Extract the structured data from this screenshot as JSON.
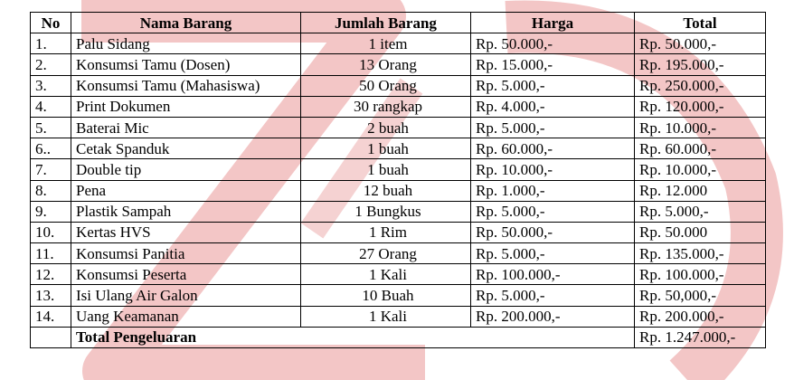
{
  "columns": {
    "no": "No",
    "item": "Nama Barang",
    "qty": "Jumlah Barang",
    "price": "Harga",
    "total": "Total"
  },
  "rows": [
    {
      "no": "1.",
      "item": "Palu Sidang",
      "qty": "1 item",
      "price": "Rp. 50.000,-",
      "total": "Rp. 50.000,-"
    },
    {
      "no": "2.",
      "item": "Konsumsi Tamu (Dosen)",
      "qty": "13 Orang",
      "price": "Rp. 15.000,-",
      "total": "Rp. 195.000,-"
    },
    {
      "no": "3.",
      "item": "Konsumsi Tamu (Mahasiswa)",
      "qty": "50 Orang",
      "price": "Rp. 5.000,-",
      "total": "Rp. 250.000,-"
    },
    {
      "no": "4.",
      "item": "Print Dokumen",
      "qty": "30 rangkap",
      "price": "Rp. 4.000,-",
      "total": "Rp. 120.000,-"
    },
    {
      "no": "5.",
      "item": "Baterai Mic",
      "qty": "2 buah",
      "price": "Rp. 5.000,-",
      "total": "Rp. 10.000,-"
    },
    {
      "no": "6..",
      "item": "Cetak Spanduk",
      "qty": "1 buah",
      "price": "Rp. 60.000,-",
      "total": "Rp. 60.000,-"
    },
    {
      "no": "7.",
      "item": "Double tip",
      "qty": "1 buah",
      "price": "Rp. 10.000,-",
      "total": "Rp. 10.000,-"
    },
    {
      "no": "8.",
      "item": "Pena",
      "qty": "12 buah",
      "price": "Rp. 1.000,-",
      "total": "Rp. 12.000"
    },
    {
      "no": "9.",
      "item": "Plastik Sampah",
      "qty": "1 Bungkus",
      "price": "Rp. 5.000,-",
      "total": "Rp. 5.000,-"
    },
    {
      "no": "10.",
      "item": "Kertas HVS",
      "qty": "1 Rim",
      "price": "Rp. 50.000,-",
      "total": "Rp. 50.000"
    },
    {
      "no": "11.",
      "item": "Konsumsi Panitia",
      "qty": "27 Orang",
      "price": "Rp. 5.000,-",
      "total": "Rp. 135.000,-"
    },
    {
      "no": "12.",
      "item": "Konsumsi Peserta",
      "qty": "1 Kali",
      "price": "Rp. 100.000,-",
      "total": "Rp. 100.000,-"
    },
    {
      "no": "13.",
      "item": "Isi Ulang Air Galon",
      "qty": "10 Buah",
      "price": "Rp. 5.000,-",
      "total": "Rp. 50,000,-"
    },
    {
      "no": "14.",
      "item": "Uang Keamanan",
      "qty": "1 Kali",
      "price": "Rp. 200.000,-",
      "total": "Rp. 200.000,-"
    }
  ],
  "footer": {
    "label": "Total Pengeluaran",
    "total": "Rp. 1.247.000,-"
  },
  "colors": {
    "watermark": "#f2c2c2"
  }
}
